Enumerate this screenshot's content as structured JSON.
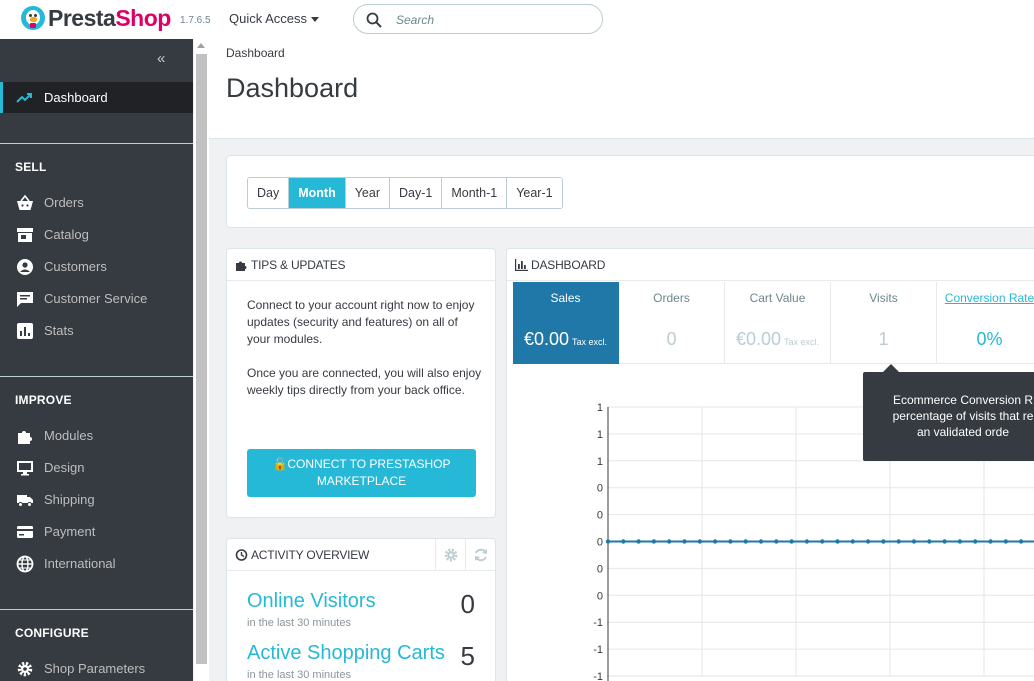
{
  "header": {
    "logo_part1": "Presta",
    "logo_part2": "Shop",
    "version": "1.7.6.5",
    "quick_access": "Quick Access",
    "search_placeholder": "Search"
  },
  "sidebar": {
    "dashboard": "Dashboard",
    "sell_title": "SELL",
    "sell_items": [
      "Orders",
      "Catalog",
      "Customers",
      "Customer Service",
      "Stats"
    ],
    "improve_title": "IMPROVE",
    "improve_items": [
      "Modules",
      "Design",
      "Shipping",
      "Payment",
      "International"
    ],
    "configure_title": "CONFIGURE",
    "configure_items": [
      "Shop Parameters"
    ]
  },
  "page": {
    "breadcrumb": "Dashboard",
    "title": "Dashboard"
  },
  "date_range": {
    "options": [
      "Day",
      "Month",
      "Year",
      "Day-1",
      "Month-1",
      "Year-1"
    ],
    "selected": "Month"
  },
  "tips": {
    "title": "TIPS & UPDATES",
    "para1": "Connect to your account right now to enjoy updates (security and features) on all of your modules.",
    "para2": "Once you are connected, you will also enjoy weekly tips directly from your back office.",
    "button_line1": "CONNECT TO PRESTASHOP",
    "button_line2": "MARKETPLACE"
  },
  "activity": {
    "title": "ACTIVITY OVERVIEW",
    "online_visitors_label": "Online Visitors",
    "online_visitors_sub": "in the last 30 minutes",
    "online_visitors_value": "0",
    "active_carts_label": "Active Shopping Carts",
    "active_carts_sub": "in the last 30 minutes",
    "active_carts_value": "5"
  },
  "dashboard": {
    "title": "DASHBOARD",
    "metrics": [
      {
        "label": "Sales",
        "value": "€0.00",
        "tax": "Tax excl."
      },
      {
        "label": "Orders",
        "value": "0",
        "tax": ""
      },
      {
        "label": "Cart Value",
        "value": "€0.00",
        "tax": "Tax excl."
      },
      {
        "label": "Visits",
        "value": "1",
        "tax": ""
      },
      {
        "label": "Conversion Rate",
        "value": "0%",
        "tax": ""
      }
    ],
    "tooltip_line1": "Ecommerce Conversion R",
    "tooltip_line2": "percentage of visits that re",
    "tooltip_line3": "an validated orde"
  },
  "chart_data": {
    "type": "line",
    "y_tick_labels": [
      "1",
      "1",
      "1",
      "0",
      "0",
      "0",
      "0",
      "0",
      "-1",
      "-1",
      "-1"
    ],
    "series": [
      {
        "values": [
          0,
          0,
          0,
          0,
          0,
          0,
          0,
          0,
          0,
          0,
          0,
          0,
          0,
          0,
          0,
          0,
          0,
          0,
          0,
          0,
          0,
          0,
          0,
          0,
          0,
          0,
          0,
          0,
          0,
          0,
          0
        ]
      }
    ],
    "color": "#1f78a8",
    "grid": true
  }
}
